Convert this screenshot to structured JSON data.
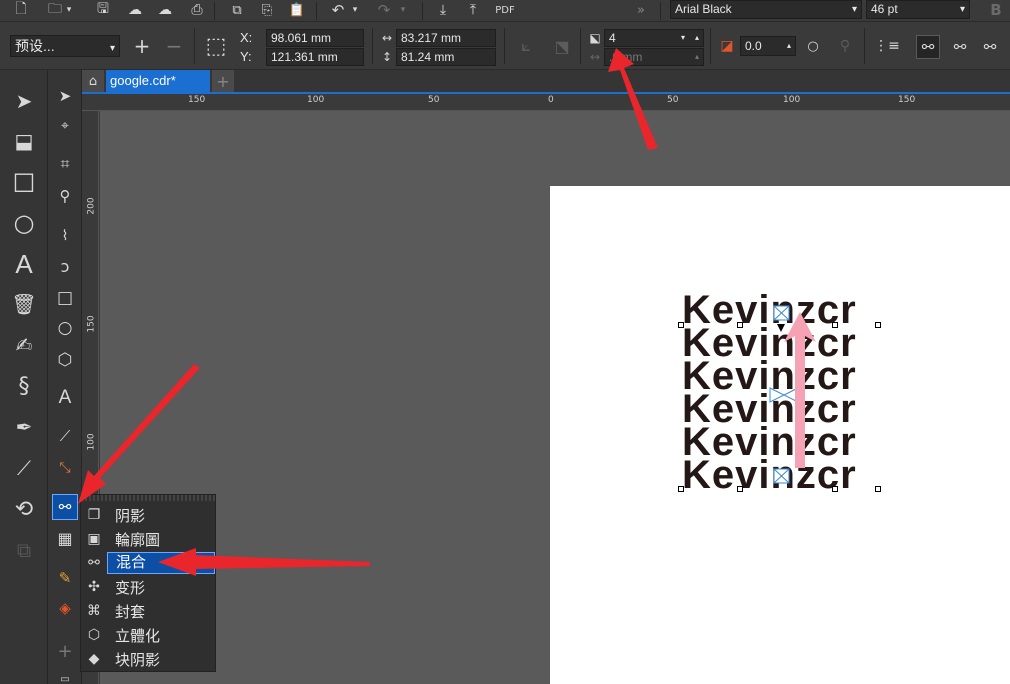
{
  "toolbar": {
    "font_name": "Arial Black",
    "font_size": "46 pt"
  },
  "propbar": {
    "preset": "预设...",
    "x_label": "X:",
    "x_value": "98.061 mm",
    "y_label": "Y:",
    "y_value": "121.361 mm",
    "width_value": "83.217 mm",
    "height_value": "81.24 mm",
    "blend_steps": "4",
    "blend_spacing": ".0 mm",
    "opacity_value": "0.0"
  },
  "document": {
    "tab_title": "google.cdr*"
  },
  "ruler": {
    "h_ticks": [
      "150",
      "100",
      "50",
      "0",
      "50",
      "100",
      "150"
    ],
    "v_ticks": [
      "200",
      "150",
      "100"
    ]
  },
  "canvas": {
    "blend_text": [
      "Kevinzcr",
      "Kevinzcr",
      "Kevinzcr",
      "Kevinzcr",
      "Kevinzcr",
      "Kevinzcr"
    ]
  },
  "flyout": {
    "items": [
      {
        "label": "阴影",
        "icon": "drop-shadow-icon"
      },
      {
        "label": "輪廓圖",
        "icon": "contour-icon"
      },
      {
        "label": "混合",
        "icon": "blend-icon"
      },
      {
        "label": "变形",
        "icon": "distort-icon"
      },
      {
        "label": "封套",
        "icon": "envelope-icon"
      },
      {
        "label": "立體化",
        "icon": "extrude-icon"
      },
      {
        "label": "块阴影",
        "icon": "block-shadow-icon"
      }
    ]
  },
  "colors": {
    "accent": "#1a6fd0",
    "arrow_red": "#e8262b",
    "arrow_pink": "#f5a3b4",
    "text": "#231815"
  }
}
